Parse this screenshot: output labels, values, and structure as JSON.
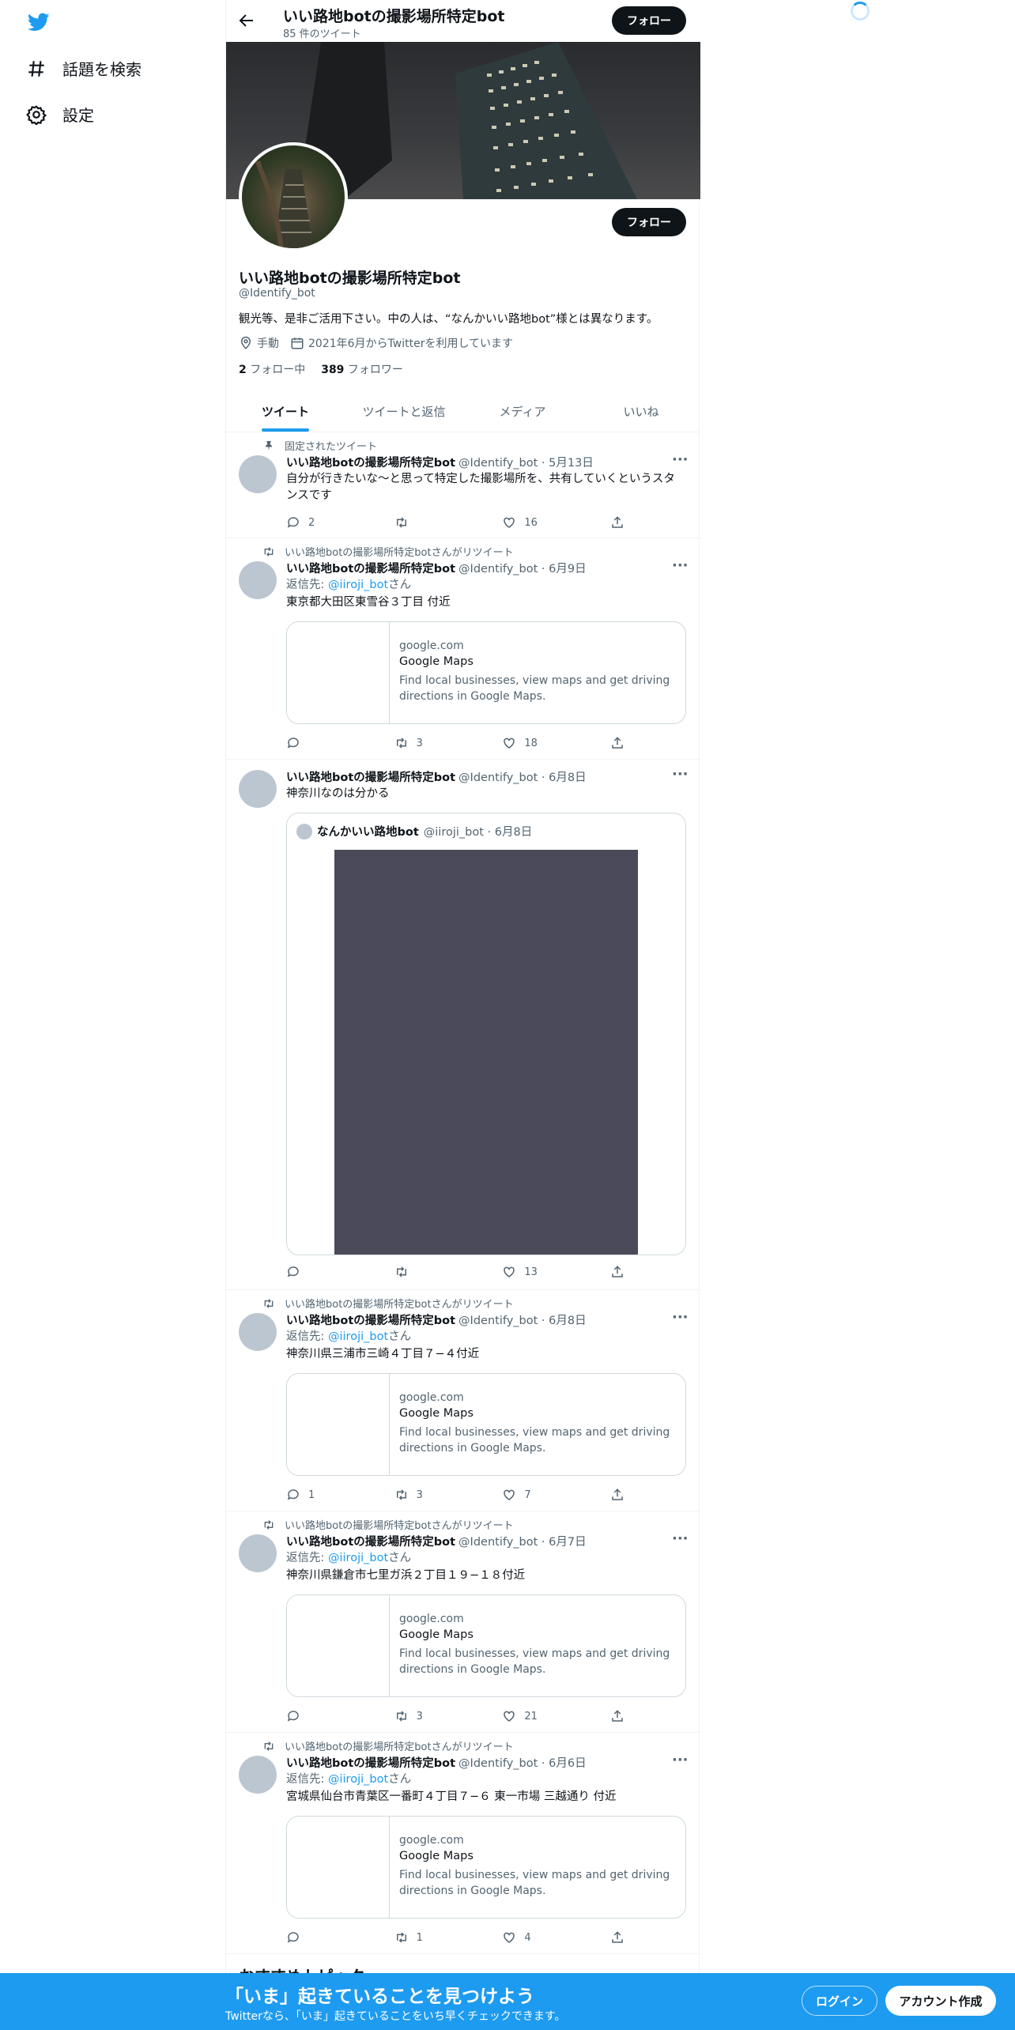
{
  "nav": {
    "logo": "twitter-bird-icon",
    "explore": "話題を検索",
    "settings": "設定"
  },
  "header": {
    "title": "いい路地botの撮影場所特定bot",
    "tweet_count": "85 件のツイート",
    "follow": "フォロー"
  },
  "profile": {
    "name": "いい路地botの撮影場所特定bot",
    "handle": "@Identify_bot",
    "bio": "観光等、是非ご活用下さい。中の人は、“なんかいい路地bot”様とは異なります。",
    "location": "手動",
    "joined": "2021年6月からTwitterを利用しています",
    "following_count": "2",
    "following_label": "フォロー中",
    "followers_count": "389",
    "followers_label": "フォロワー",
    "follow": "フォロー"
  },
  "tabs": [
    "ツイート",
    "ツイートと返信",
    "メディア",
    "いいね"
  ],
  "tweets": [
    {
      "context": "固定されたツイート",
      "name": "いい路地botの撮影場所特定bot",
      "meta": "@Identify_bot · 5月13日",
      "text": "自分が行きたいな〜と思って特定した撮影場所を、共有していくというスタンスです",
      "reply": "2",
      "retweet": "",
      "like": "16"
    },
    {
      "context": "いい路地botの撮影場所特定botさんがリツイート",
      "name": "いい路地botの撮影場所特定bot",
      "meta": "@Identify_bot · 6月9日",
      "reply_prefix": "返信先: ",
      "reply_to": "@iiroji_bot",
      "reply_suffix": "さん",
      "text": "東京都大田区東雪谷３丁目 付近",
      "card": {
        "domain": "google.com",
        "title": "Google Maps",
        "desc": "Find local businesses, view maps and get driving directions in Google Maps."
      },
      "reply": "",
      "retweet": "3",
      "like": "18"
    },
    {
      "name": "いい路地botの撮影場所特定bot",
      "meta": "@Identify_bot · 6月8日",
      "text": "神奈川なのは分かる",
      "quote": {
        "name": "なんかいい路地bot",
        "meta": "@iiroji_bot · 6月8日"
      },
      "reply": "",
      "retweet": "",
      "like": "13"
    },
    {
      "context": "いい路地botの撮影場所特定botさんがリツイート",
      "name": "いい路地botの撮影場所特定bot",
      "meta": "@Identify_bot · 6月8日",
      "reply_prefix": "返信先: ",
      "reply_to": "@iiroji_bot",
      "reply_suffix": "さん",
      "text": "神奈川県三浦市三崎４丁目７−４付近",
      "card": {
        "domain": "google.com",
        "title": "Google Maps",
        "desc": "Find local businesses, view maps and get driving directions in Google Maps."
      },
      "reply": "1",
      "retweet": "3",
      "like": "7"
    },
    {
      "context": "いい路地botの撮影場所特定botさんがリツイート",
      "name": "いい路地botの撮影場所特定bot",
      "meta": "@Identify_bot · 6月7日",
      "reply_prefix": "返信先: ",
      "reply_to": "@iiroji_bot",
      "reply_suffix": "さん",
      "text": "神奈川県鎌倉市七里ガ浜２丁目１９−１８付近",
      "card": {
        "domain": "google.com",
        "title": "Google Maps",
        "desc": "Find local businesses, view maps and get driving directions in Google Maps."
      },
      "reply": "",
      "retweet": "3",
      "like": "21"
    },
    {
      "context": "いい路地botの撮影場所特定botさんがリツイート",
      "name": "いい路地botの撮影場所特定bot",
      "meta": "@Identify_bot · 6月6日",
      "reply_prefix": "返信先: ",
      "reply_to": "@iiroji_bot",
      "reply_suffix": "さん",
      "text": "宮城県仙台市青葉区一番町４丁目７−６ 東一市場 三越通り 付近",
      "card": {
        "domain": "google.com",
        "title": "Google Maps",
        "desc": "Find local businesses, view maps and get driving directions in Google Maps."
      },
      "reply": "",
      "retweet": "1",
      "like": "4"
    }
  ],
  "trends_heading": "おすすめトピック",
  "bottom_bar": {
    "title": "「いま」起きていることを見つけよう",
    "subtitle": "Twitterなら、「いま」起きていることをいち早くチェックできます。",
    "login": "ログイン",
    "signup": "アカウント作成"
  },
  "colors": {
    "accent": "#1d9bf0",
    "text": "#0f1419",
    "muted": "#536471"
  }
}
